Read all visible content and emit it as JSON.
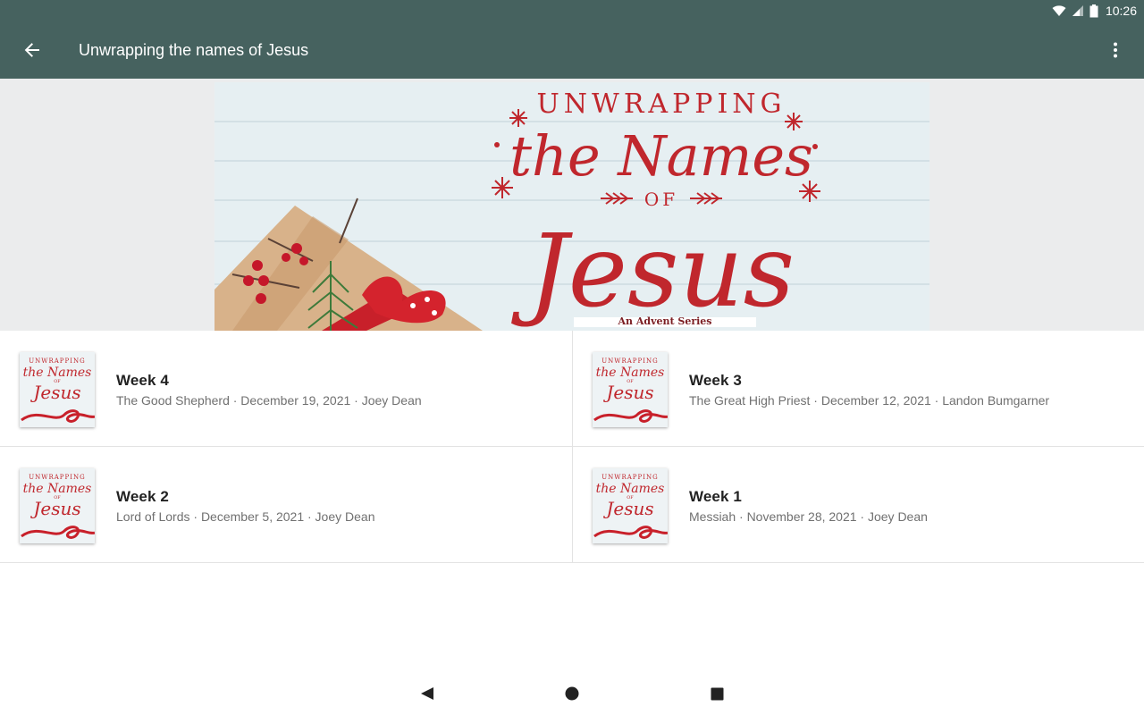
{
  "status_bar": {
    "time": "10:26",
    "icons": [
      "wifi-icon",
      "cell-signal-icon",
      "battery-icon"
    ]
  },
  "app_bar": {
    "title": "Unwrapping the names of Jesus",
    "back_icon": "arrow-left-icon",
    "menu_icon": "more-vert-icon"
  },
  "banner": {
    "line1": "UNWRAPPING",
    "line2": "the Names",
    "line3": "OF",
    "line4": "Jesus",
    "subtitle": "An Advent Series"
  },
  "thumbnail": {
    "line1": "UNWRAPPING",
    "line2": "the Names",
    "line3": "OF",
    "line4": "Jesus"
  },
  "items": [
    {
      "title": "Week 4",
      "subtitle": "The Good Shepherd · December 19, 2021 · Joey Dean"
    },
    {
      "title": "Week 3",
      "subtitle": "The Great High Priest · December 12, 2021 · Landon Bumgarner"
    },
    {
      "title": "Week 2",
      "subtitle": "Lord of Lords · December 5, 2021 · Joey Dean"
    },
    {
      "title": "Week 1",
      "subtitle": "Messiah · November 28, 2021 · Joey Dean"
    }
  ],
  "nav_bar": {
    "icons": [
      "back-triangle-icon",
      "home-circle-icon",
      "recents-square-icon"
    ]
  },
  "colors": {
    "app_bar": "#46625f",
    "accent_red": "#c0272d",
    "banner_bg": "#e3edf0"
  }
}
